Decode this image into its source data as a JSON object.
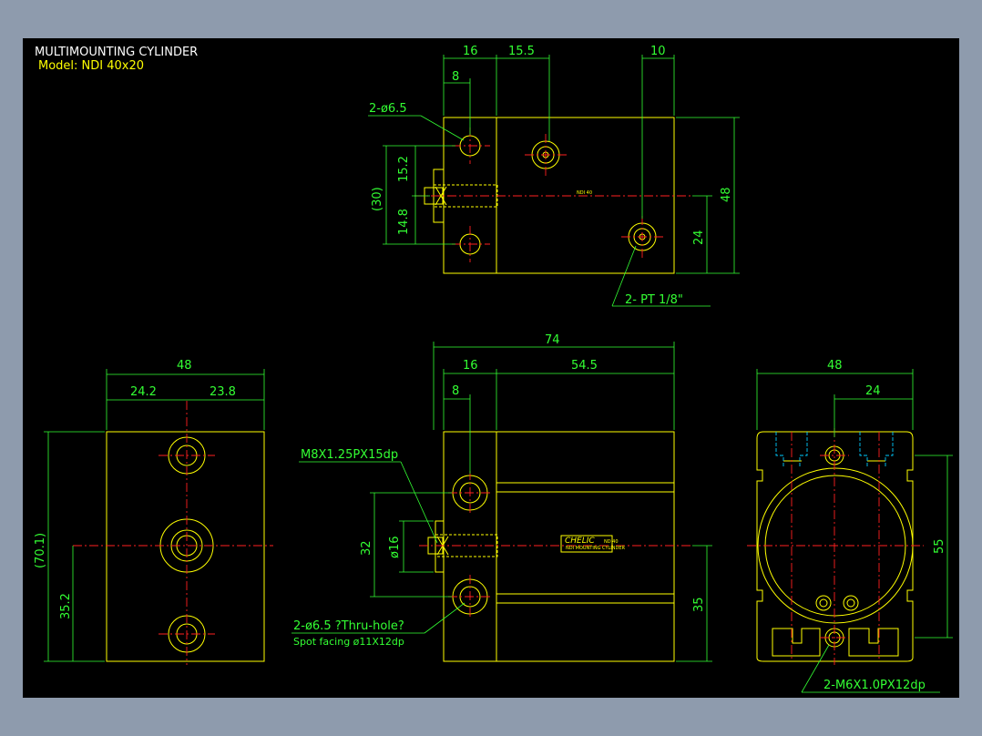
{
  "drawing": {
    "title": "MULTIMOUNTING CYLINDER",
    "model": "Model:  NDI  40x20",
    "top_view": {
      "dim_16": "16",
      "dim_15_5": "15.5",
      "dim_10": "10",
      "dim_8": "8",
      "hole_note": "2-ø6.5",
      "dim_15_2": "15.2",
      "dim_30": "(30)",
      "dim_14_8": "14.8",
      "dim_48": "48",
      "dim_24": "24",
      "port_note": "2- PT 1/8\"",
      "tiny_label": "NDI 40"
    },
    "left_view": {
      "dim_48": "48",
      "dim_24_2": "24.2",
      "dim_23_8": "23.8",
      "dim_70_1": "(70.1)",
      "dim_35_2": "35.2"
    },
    "front_view": {
      "dim_74": "74",
      "dim_16": "16",
      "dim_54_5": "54.5",
      "dim_8": "8",
      "thread_note": "M8X1.25PX15dp",
      "dim_32": "32",
      "dim_dia16": "ø16",
      "dim_35": "35",
      "hole_note": "2-ø6.5 ?Thru-hole?",
      "spot_note": "Spot facing  ø11X12dp",
      "brand": "CHELIC",
      "brand_sub": "NDI MOUNTING CYLINDER",
      "brand_model": "ND 40"
    },
    "right_view": {
      "dim_48": "48",
      "dim_24": "24",
      "dim_55": "55",
      "thread_note": "2-M6X1.0PX12dp"
    }
  },
  "colors": {
    "background": "#8e9bad",
    "canvas": "#000000",
    "outline": "#ffff00",
    "dimension": "#33ff33",
    "centerline": "#ff2020",
    "hidden": "#00ccff"
  }
}
